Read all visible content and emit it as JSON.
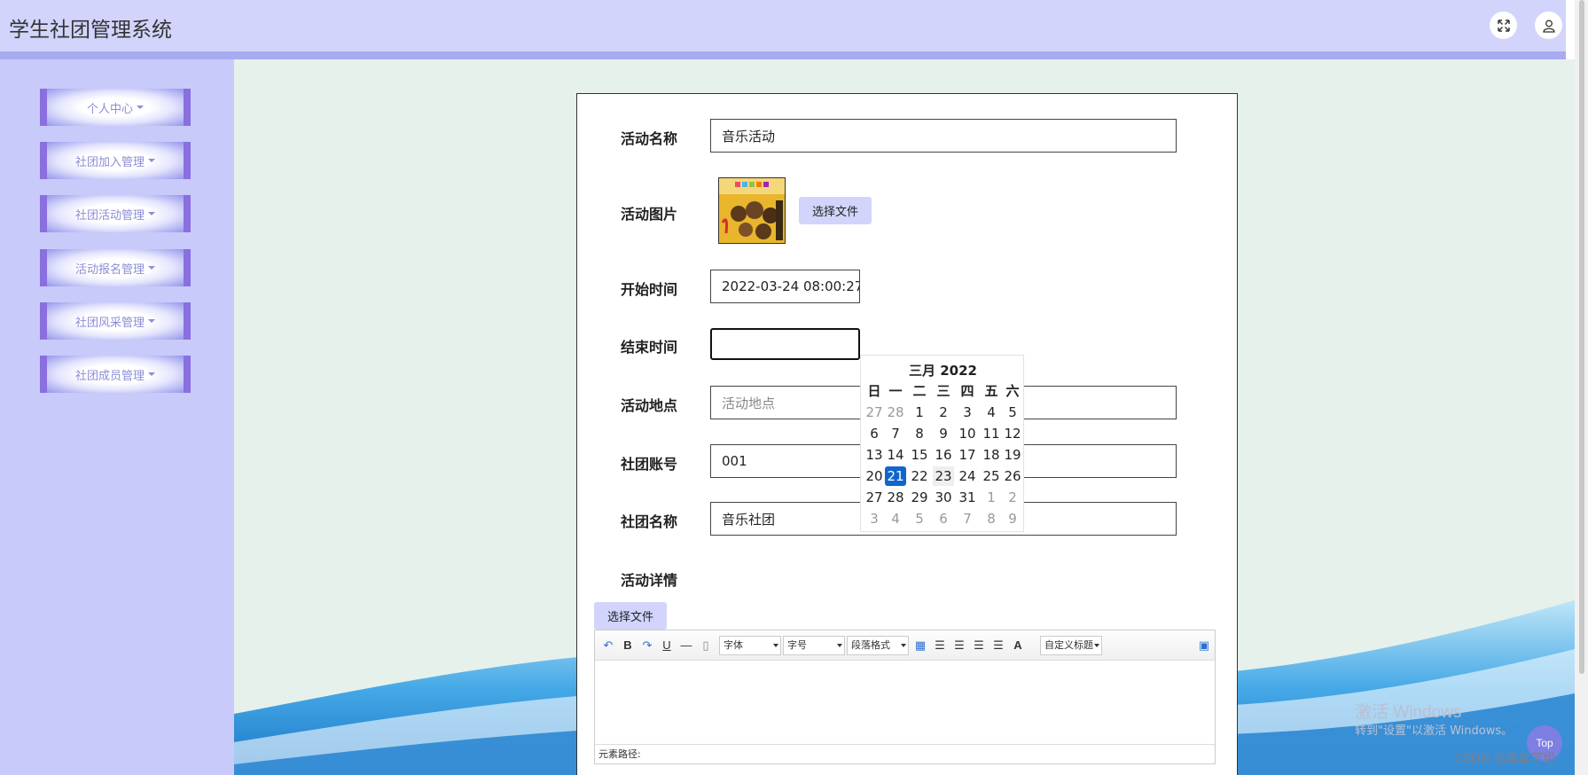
{
  "header": {
    "title": "学生社团管理系统",
    "fullscreen_icon": "expand-icon",
    "user_icon": "user-icon"
  },
  "sidebar": {
    "items": [
      {
        "label": "个人中心"
      },
      {
        "label": "社团加入管理"
      },
      {
        "label": "社团活动管理"
      },
      {
        "label": "活动报名管理"
      },
      {
        "label": "社团风采管理"
      },
      {
        "label": "社团成员管理"
      }
    ]
  },
  "form": {
    "activity_name": {
      "label": "活动名称",
      "value": "音乐活动"
    },
    "activity_image": {
      "label": "活动图片",
      "button": "选择文件"
    },
    "start_time": {
      "label": "开始时间",
      "value": "2022-03-24 08:00:27"
    },
    "end_time": {
      "label": "结束时间",
      "value": ""
    },
    "location": {
      "label": "活动地点",
      "placeholder": "活动地点"
    },
    "club_account": {
      "label": "社团账号",
      "value": "001"
    },
    "club_name": {
      "label": "社团名称",
      "value": "音乐社团"
    },
    "details": {
      "label": "活动详情",
      "button": "选择文件"
    }
  },
  "calendar": {
    "title": "三月 2022",
    "weekdays": [
      "日",
      "一",
      "二",
      "三",
      "四",
      "五",
      "六"
    ],
    "weeks": [
      [
        "27",
        "28",
        "1",
        "2",
        "3",
        "4",
        "5"
      ],
      [
        "6",
        "7",
        "8",
        "9",
        "10",
        "11",
        "12"
      ],
      [
        "13",
        "14",
        "15",
        "16",
        "17",
        "18",
        "19"
      ],
      [
        "20",
        "21",
        "22",
        "23",
        "24",
        "25",
        "26"
      ],
      [
        "27",
        "28",
        "29",
        "30",
        "31",
        "1",
        "2"
      ],
      [
        "3",
        "4",
        "5",
        "6",
        "7",
        "8",
        "9"
      ]
    ],
    "selected": "21",
    "hovered": "23"
  },
  "editor": {
    "font_select": "字体",
    "size_select": "字号",
    "paragraph_select": "段落格式",
    "custom_title_select": "自定义标题",
    "bold": "B",
    "underline": "U",
    "font_color": "A",
    "status_path": "元素路径:"
  },
  "overlay": {
    "top_button": "Top",
    "watermark_title": "激活 Windows",
    "watermark_sub": "转到\"设置\"以激活 Windows。",
    "csdn": "CSDN @其其学姐"
  },
  "colors": {
    "header_bg": "#d2d4fb",
    "sidebar_bg": "#c8cafa",
    "main_bg": "#e5f1ea",
    "accent": "#8a6fe0",
    "selected_day": "#1166cc"
  }
}
